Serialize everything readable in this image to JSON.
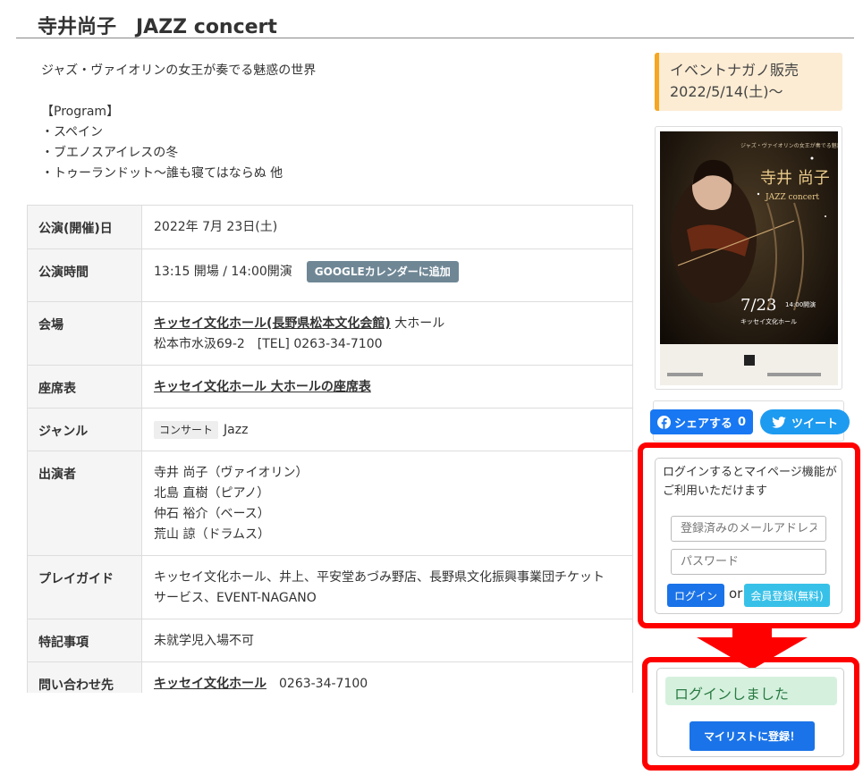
{
  "page": {
    "title": "寺井尚子　JAZZ concert",
    "description": [
      "ジャズ・ヴァイオリンの女王が奏でる魅惑の世界",
      "",
      "【Program】",
      "・スペイン",
      "・ブエノスアイレスの冬",
      "・トゥーランドット～誰も寝てはならぬ 他"
    ]
  },
  "info": {
    "date": {
      "label": "公演(開催)日",
      "value": "2022年 7月 23日(土)"
    },
    "time": {
      "label": "公演時間",
      "value": "13:15 開場 / 14:00開演",
      "gcal_button": "GOOGLEカレンダーに追加"
    },
    "venue": {
      "label": "会場",
      "link": "キッセイ文化ホール(長野県松本文化会館)",
      "hall": " 大ホール",
      "address": "松本市水汲69-2　[TEL] 0263-34-7100"
    },
    "seating": {
      "label": "座席表",
      "link": "キッセイ文化ホール 大ホールの座席表"
    },
    "genre": {
      "label": "ジャンル",
      "tag": "コンサート",
      "value": "Jazz"
    },
    "performers": {
      "label": "出演者",
      "lines": [
        "寺井 尚子（ヴァイオリン）",
        "北島 直樹（ピアノ）",
        "仲石 裕介（ベース）",
        "荒山 諒（ドラムス）"
      ]
    },
    "playguide": {
      "label": "プレイガイド",
      "lines": [
        "キッセイ文化ホール、井上、平安堂あづみ野店、長野県文化振興事業団チケット",
        "サービス、EVENT-NAGANO"
      ]
    },
    "notes": {
      "label": "特記事項",
      "value": "未就学児入場不可"
    },
    "contact": {
      "label": "問い合わせ先",
      "link": "キッセイ文化ホール",
      "tel": "0263-34-7100"
    }
  },
  "sidebar": {
    "sale_title": "イベントナガノ販売",
    "sale_date": "2022/5/14(土)〜",
    "poster": {
      "name": "寺井 尚子",
      "subtitle": "JAZZ concert",
      "catch": "ジャズ・ヴァイオリンの女王が奏でる魅惑の世界",
      "date": "7/23",
      "time": "14:00開演",
      "venue": "キッセイ文化ホール"
    },
    "share_fb": "シェアする",
    "share_count": "0",
    "share_tw": "ツイート"
  },
  "login": {
    "message": "ログインするとマイページ機能がご利用いただけます",
    "email_placeholder": "登録済みのメールアドレス",
    "password_placeholder": "パスワード",
    "login_button": "ログイン",
    "or": "or",
    "register_button": "会員登録(無料)",
    "success": "ログインしました",
    "mylist_button": "マイリストに登録！"
  },
  "colors": {
    "highlight": "#ff0000",
    "accent": "#1a73e8",
    "sale_border": "#f5a623",
    "success_bg": "#d5f1de"
  }
}
